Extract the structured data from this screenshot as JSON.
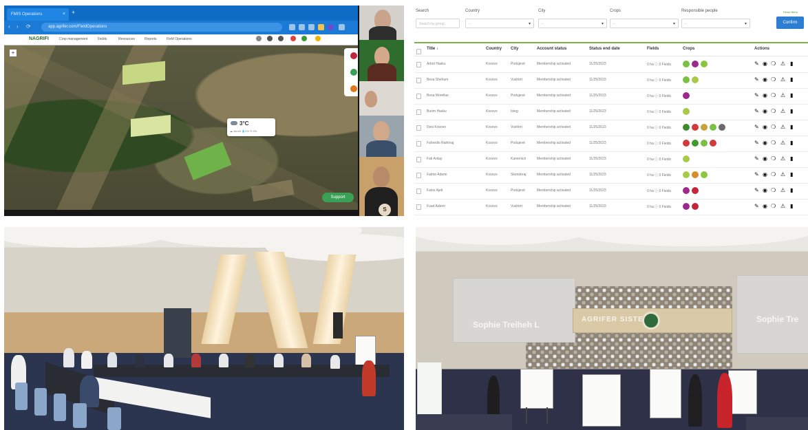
{
  "video_call": {
    "browser": {
      "tab_title": "FMIS Operations",
      "tab_close": "×",
      "new_tab": "+",
      "url": "app.agrifer.com/FieldOperations",
      "nav_back": "‹",
      "nav_forward": "›",
      "nav_reload": "⟳"
    },
    "app": {
      "brand": "NAGRIFI",
      "menu": [
        "Crop management",
        "Fields",
        "Resources",
        "Reports",
        "Field Operations"
      ]
    },
    "map": {
      "zoom_label": "+",
      "weather_temp": "3°C",
      "weather_details": "☁ 1km/h  💧0%  ⊙ 0%",
      "support_label": "Support"
    },
    "participant_badge": "S"
  },
  "farmers_table": {
    "filters": [
      {
        "label": "Search",
        "placeholder": "Search by group..."
      },
      {
        "label": "Country",
        "placeholder": "--"
      },
      {
        "label": "City",
        "placeholder": "--"
      },
      {
        "label": "Crops",
        "placeholder": "--"
      },
      {
        "label": "Responsible people",
        "placeholder": "--"
      }
    ],
    "reset_label": "Reset filters",
    "confirm_label": "Confirm",
    "columns": [
      "Title ↓",
      "Country",
      "City",
      "Account status",
      "Status end date",
      "Fields",
      "Crops",
      "Actions"
    ],
    "rows": [
      {
        "title": "Arbnt Hasku",
        "country": "Kosovo",
        "city": "Podujevë",
        "status": "Membership activated",
        "date": "11/25/2023",
        "fields": "0 ha ⓘ 0 Fields",
        "crops": [
          "#7ac143",
          "#9b2a8a",
          "#8cc63f"
        ]
      },
      {
        "title": "Besa Shehum",
        "country": "Kosovo",
        "city": "Vushtrri",
        "status": "Membership activated",
        "date": "11/25/2023",
        "fields": "0 ha ⓘ 0 Fields",
        "crops": [
          "#7ac143",
          "#a8c94a"
        ]
      },
      {
        "title": "Besa Morellas",
        "country": "Kosovo",
        "city": "Podujevë",
        "status": "Membership activated",
        "date": "11/25/2023",
        "fields": "0 ha ⓘ 0 Fields",
        "crops": [
          "#9b2a8a"
        ]
      },
      {
        "title": "Burim Hasku",
        "country": "Kosovo",
        "city": "Istog",
        "status": "Membership activated",
        "date": "11/25/2023",
        "fields": "0 ha ⓘ 0 Fields",
        "crops": [
          "#a8c94a"
        ]
      },
      {
        "title": "Desi Kosovo",
        "country": "Kosovo",
        "city": "Vushtrri",
        "status": "Membership activated",
        "date": "11/25/2023",
        "fields": "0 ha ⓘ 0 Fields",
        "crops": [
          "#3f8a2a",
          "#d23a3a",
          "#c8a23a",
          "#7ac143",
          "#6b6b6b"
        ]
      },
      {
        "title": "Fahredin Rahimaj",
        "country": "Kosovo",
        "city": "Podujevë",
        "status": "Membership activated",
        "date": "11/25/2023",
        "fields": "0 ha ⓘ 0 Fields",
        "crops": [
          "#d23a3a",
          "#3f9a2a",
          "#7ac143",
          "#d23a3a"
        ]
      },
      {
        "title": "Fati Arday",
        "country": "Kosovo",
        "city": "Kamenicë",
        "status": "Membership activated",
        "date": "11/25/2023",
        "fields": "0 ha ⓘ 0 Fields",
        "crops": [
          "#a8c94a"
        ]
      },
      {
        "title": "Fatmir Ademi",
        "country": "Kosovo",
        "city": "Skenderaj",
        "status": "Membership activated",
        "date": "11/25/2023",
        "fields": "0 ha ⓘ 0 Fields",
        "crops": [
          "#a8c94a",
          "#d98a2a",
          "#8cc63f"
        ]
      },
      {
        "title": "Fatos Ajeti",
        "country": "Kosovo",
        "city": "Podujevë",
        "status": "Membership activated",
        "date": "11/25/2023",
        "fields": "0 ha ⓘ 0 Fields",
        "crops": [
          "#9b2a8a",
          "#c2263a"
        ]
      },
      {
        "title": "Fuad Ademi",
        "country": "Kosovo",
        "city": "Vushtrri",
        "status": "Membership activated",
        "date": "11/25/2023",
        "fields": "0 ha ⓘ 0 Fields",
        "crops": [
          "#9b2a8a",
          "#c2263a"
        ]
      }
    ],
    "action_icons": [
      "pencil-icon",
      "eye-icon",
      "comments-icon",
      "warning-icon",
      "trash-icon"
    ],
    "action_glyphs": [
      "✎",
      "◉",
      "❍",
      "⚠",
      "▮"
    ]
  },
  "stage": {
    "screen_left_text": "Sophie Treiheh L",
    "screen_right_text": "Sophie Tre",
    "banner_text": "AGRIFER   SISTEMI"
  }
}
